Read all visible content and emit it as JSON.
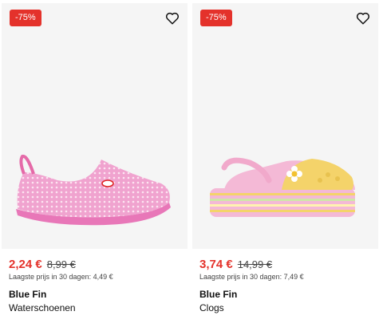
{
  "products": [
    {
      "discount": "-75%",
      "price_now": "2,24 €",
      "price_old": "8,99 €",
      "lowest_price": "Laagste prijs in 30 dagen: 4,49 €",
      "brand": "Blue Fin",
      "name": "Waterschoenen",
      "colors": {
        "main": "#f0a3cf",
        "sole": "#e877b8"
      }
    },
    {
      "discount": "-75%",
      "price_now": "3,74 €",
      "price_old": "14,99 €",
      "lowest_price": "Laagste prijs in 30 dagen: 7,49 €",
      "brand": "Blue Fin",
      "name": "Clogs",
      "colors": {
        "main": "#f4d36a",
        "sole": "#f4b9d6"
      }
    }
  ],
  "colors": {
    "badge": "#e4322b",
    "price": "#e4322b",
    "image_bg": "#f5f5f5"
  },
  "icons": {
    "favorite": "heart-icon"
  }
}
